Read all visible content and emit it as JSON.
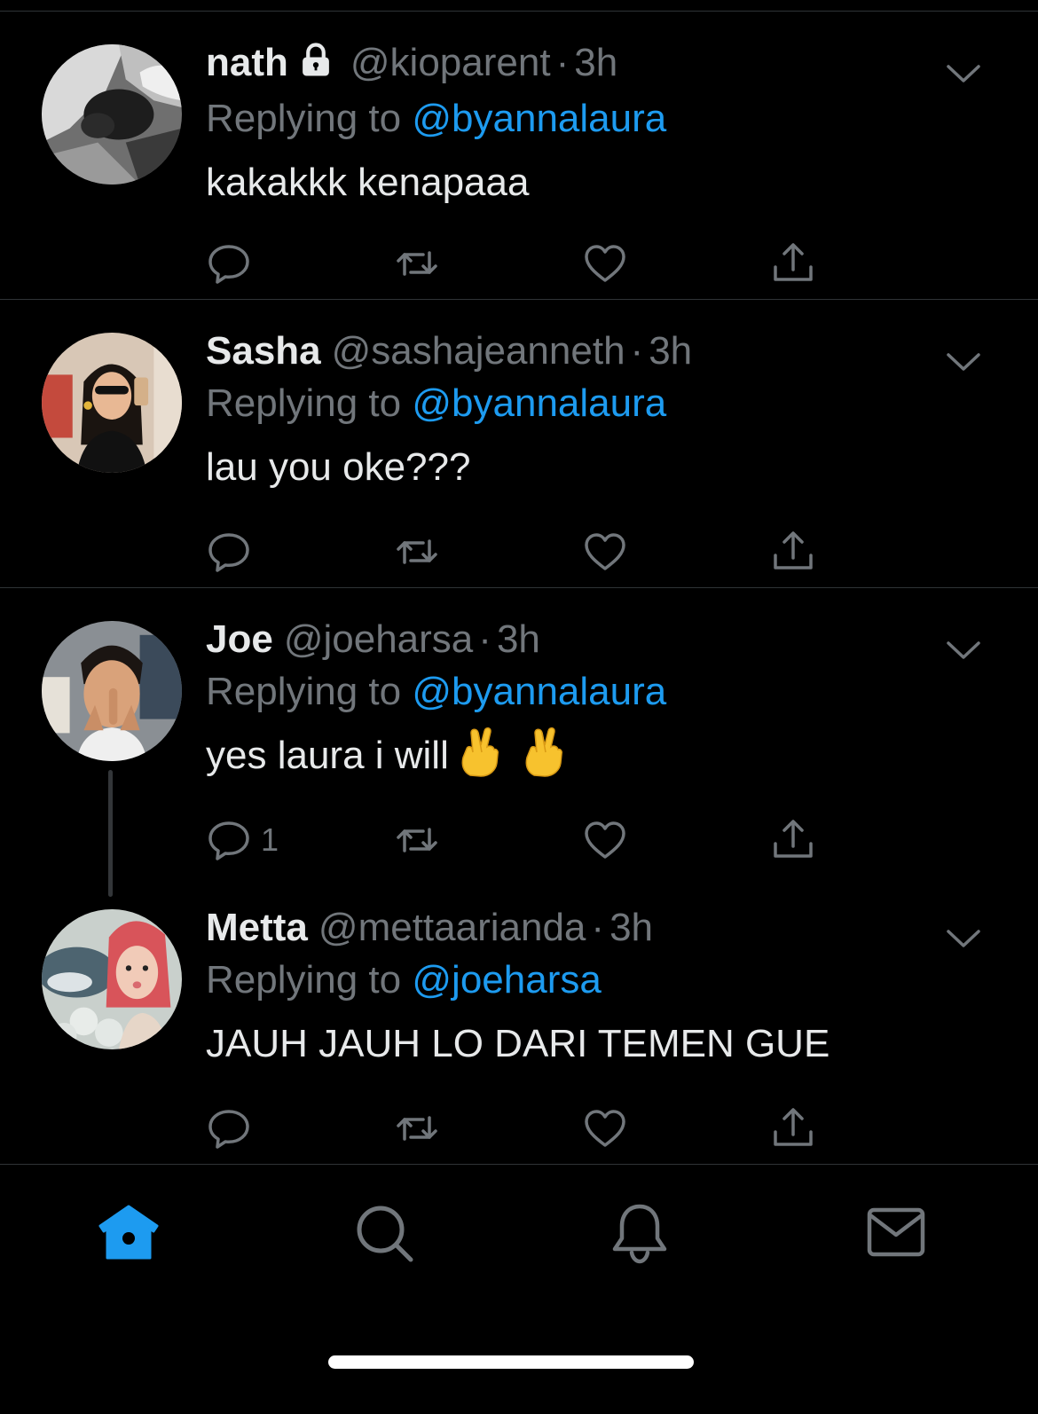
{
  "colors": {
    "background": "#000000",
    "primary_text": "#e7e9ea",
    "secondary_text": "#71767b",
    "accent": "#1d9bf0",
    "divider": "#2f3336"
  },
  "tweets": [
    {
      "display_name": "nath",
      "locked": true,
      "handle": "@kioparent",
      "separator": "·",
      "time": "3h",
      "replying_prefix": "Replying to",
      "replying_to": "@byannalaura",
      "text": "kakakkk kenapaaa",
      "reply_count": ""
    },
    {
      "display_name": "Sasha",
      "locked": false,
      "handle": "@sashajeanneth",
      "separator": "·",
      "time": "3h",
      "replying_prefix": "Replying to",
      "replying_to": "@byannalaura",
      "text": "lau you oke???",
      "reply_count": ""
    },
    {
      "display_name": "Joe",
      "locked": false,
      "handle": "@joeharsa",
      "separator": "·",
      "time": "3h",
      "replying_prefix": "Replying to",
      "replying_to": "@byannalaura",
      "text": "yes laura i will",
      "emoji": "crossed-fingers",
      "reply_count": "1"
    },
    {
      "display_name": "Metta",
      "locked": false,
      "handle": "@mettaarianda",
      "separator": "·",
      "time": "3h",
      "replying_prefix": "Replying to",
      "replying_to": "@joeharsa",
      "text": "JAUH JAUH LO DARI TEMEN GUE",
      "reply_count": ""
    }
  ],
  "tab_bar": {
    "active": "home",
    "tabs": [
      "home-icon",
      "search-icon",
      "bell-icon",
      "mail-icon"
    ]
  }
}
